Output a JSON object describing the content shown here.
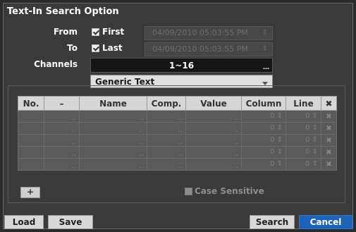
{
  "dialog": {
    "title": "Text-In Search Option",
    "from": {
      "label": "From",
      "checkbox_label": "First",
      "checked": true,
      "datetime": "04/09/2010  05:03:55 PM"
    },
    "to": {
      "label": "To",
      "checkbox_label": "Last",
      "checked": true,
      "datetime": "04/09/2010  05:03:55 PM"
    },
    "channels": {
      "label": "Channels",
      "value": "1~16"
    },
    "text_type": {
      "selected": "Generic Text"
    },
    "table": {
      "headers": [
        "No.",
        "–",
        "Name",
        "Comp.",
        "Value",
        "Column",
        "Line",
        "✖"
      ],
      "rows": [
        {
          "column": "0",
          "line": "0"
        },
        {
          "column": "0",
          "line": "0"
        },
        {
          "column": "0",
          "line": "0"
        },
        {
          "column": "0",
          "line": "0"
        },
        {
          "column": "0",
          "line": "0"
        }
      ]
    },
    "add_label": "+",
    "case_sensitive": {
      "label": "Case Sensitive",
      "checked": false
    },
    "buttons": {
      "load": "Load",
      "save": "Save",
      "search": "Search",
      "cancel": "Cancel"
    }
  },
  "colors": {
    "accent": "#1b63b8",
    "background": "#3a3a3a"
  },
  "icons": {
    "spin": "spin-arrows-icon",
    "remove": "delete-x-icon",
    "browse": "ellipsis-icon"
  }
}
